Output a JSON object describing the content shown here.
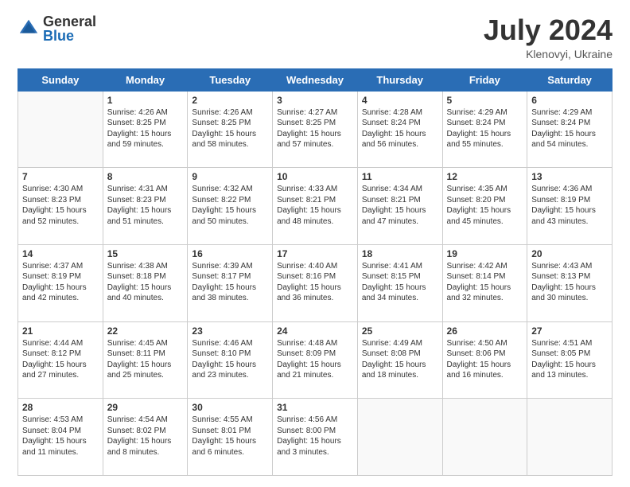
{
  "logo": {
    "general": "General",
    "blue": "Blue"
  },
  "header": {
    "month_year": "July 2024",
    "location": "Klenovyi, Ukraine"
  },
  "weekdays": [
    "Sunday",
    "Monday",
    "Tuesday",
    "Wednesday",
    "Thursday",
    "Friday",
    "Saturday"
  ],
  "weeks": [
    [
      {
        "day": "",
        "empty": true
      },
      {
        "day": "1",
        "sunrise": "4:26 AM",
        "sunset": "8:25 PM",
        "daylight": "15 hours and 59 minutes."
      },
      {
        "day": "2",
        "sunrise": "4:26 AM",
        "sunset": "8:25 PM",
        "daylight": "15 hours and 58 minutes."
      },
      {
        "day": "3",
        "sunrise": "4:27 AM",
        "sunset": "8:25 PM",
        "daylight": "15 hours and 57 minutes."
      },
      {
        "day": "4",
        "sunrise": "4:28 AM",
        "sunset": "8:24 PM",
        "daylight": "15 hours and 56 minutes."
      },
      {
        "day": "5",
        "sunrise": "4:29 AM",
        "sunset": "8:24 PM",
        "daylight": "15 hours and 55 minutes."
      },
      {
        "day": "6",
        "sunrise": "4:29 AM",
        "sunset": "8:24 PM",
        "daylight": "15 hours and 54 minutes."
      }
    ],
    [
      {
        "day": "7",
        "sunrise": "4:30 AM",
        "sunset": "8:23 PM",
        "daylight": "15 hours and 52 minutes."
      },
      {
        "day": "8",
        "sunrise": "4:31 AM",
        "sunset": "8:23 PM",
        "daylight": "15 hours and 51 minutes."
      },
      {
        "day": "9",
        "sunrise": "4:32 AM",
        "sunset": "8:22 PM",
        "daylight": "15 hours and 50 minutes."
      },
      {
        "day": "10",
        "sunrise": "4:33 AM",
        "sunset": "8:21 PM",
        "daylight": "15 hours and 48 minutes."
      },
      {
        "day": "11",
        "sunrise": "4:34 AM",
        "sunset": "8:21 PM",
        "daylight": "15 hours and 47 minutes."
      },
      {
        "day": "12",
        "sunrise": "4:35 AM",
        "sunset": "8:20 PM",
        "daylight": "15 hours and 45 minutes."
      },
      {
        "day": "13",
        "sunrise": "4:36 AM",
        "sunset": "8:19 PM",
        "daylight": "15 hours and 43 minutes."
      }
    ],
    [
      {
        "day": "14",
        "sunrise": "4:37 AM",
        "sunset": "8:19 PM",
        "daylight": "15 hours and 42 minutes."
      },
      {
        "day": "15",
        "sunrise": "4:38 AM",
        "sunset": "8:18 PM",
        "daylight": "15 hours and 40 minutes."
      },
      {
        "day": "16",
        "sunrise": "4:39 AM",
        "sunset": "8:17 PM",
        "daylight": "15 hours and 38 minutes."
      },
      {
        "day": "17",
        "sunrise": "4:40 AM",
        "sunset": "8:16 PM",
        "daylight": "15 hours and 36 minutes."
      },
      {
        "day": "18",
        "sunrise": "4:41 AM",
        "sunset": "8:15 PM",
        "daylight": "15 hours and 34 minutes."
      },
      {
        "day": "19",
        "sunrise": "4:42 AM",
        "sunset": "8:14 PM",
        "daylight": "15 hours and 32 minutes."
      },
      {
        "day": "20",
        "sunrise": "4:43 AM",
        "sunset": "8:13 PM",
        "daylight": "15 hours and 30 minutes."
      }
    ],
    [
      {
        "day": "21",
        "sunrise": "4:44 AM",
        "sunset": "8:12 PM",
        "daylight": "15 hours and 27 minutes."
      },
      {
        "day": "22",
        "sunrise": "4:45 AM",
        "sunset": "8:11 PM",
        "daylight": "15 hours and 25 minutes."
      },
      {
        "day": "23",
        "sunrise": "4:46 AM",
        "sunset": "8:10 PM",
        "daylight": "15 hours and 23 minutes."
      },
      {
        "day": "24",
        "sunrise": "4:48 AM",
        "sunset": "8:09 PM",
        "daylight": "15 hours and 21 minutes."
      },
      {
        "day": "25",
        "sunrise": "4:49 AM",
        "sunset": "8:08 PM",
        "daylight": "15 hours and 18 minutes."
      },
      {
        "day": "26",
        "sunrise": "4:50 AM",
        "sunset": "8:06 PM",
        "daylight": "15 hours and 16 minutes."
      },
      {
        "day": "27",
        "sunrise": "4:51 AM",
        "sunset": "8:05 PM",
        "daylight": "15 hours and 13 minutes."
      }
    ],
    [
      {
        "day": "28",
        "sunrise": "4:53 AM",
        "sunset": "8:04 PM",
        "daylight": "15 hours and 11 minutes."
      },
      {
        "day": "29",
        "sunrise": "4:54 AM",
        "sunset": "8:02 PM",
        "daylight": "15 hours and 8 minutes."
      },
      {
        "day": "30",
        "sunrise": "4:55 AM",
        "sunset": "8:01 PM",
        "daylight": "15 hours and 6 minutes."
      },
      {
        "day": "31",
        "sunrise": "4:56 AM",
        "sunset": "8:00 PM",
        "daylight": "15 hours and 3 minutes."
      },
      {
        "day": "",
        "empty": true
      },
      {
        "day": "",
        "empty": true
      },
      {
        "day": "",
        "empty": true
      }
    ]
  ]
}
